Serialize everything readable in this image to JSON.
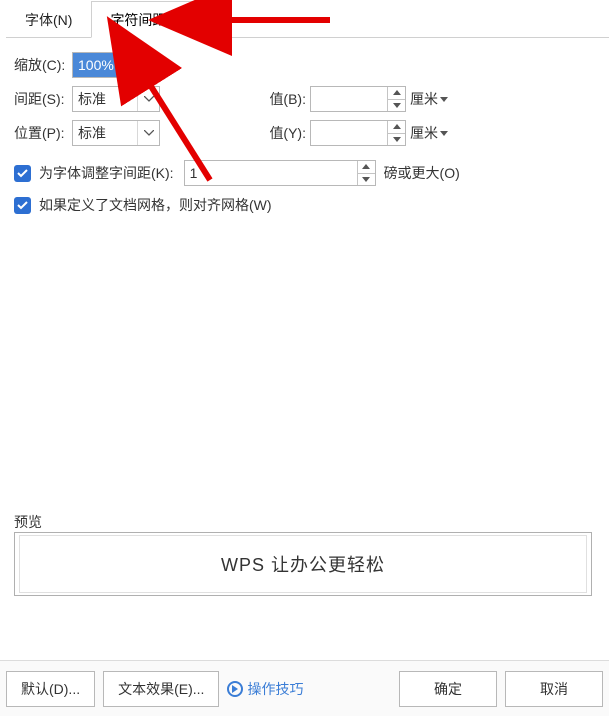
{
  "tabs": {
    "font": "字体(N)",
    "spacing": "字符间距(R)"
  },
  "labels": {
    "scale": "缩放(C):",
    "spacing": "间距(S):",
    "position": "位置(P):",
    "valueB": "值(B):",
    "valueY": "值(Y):",
    "cm": "厘米",
    "ptOrLarger": "磅或更大(O)",
    "kerning": "为字体调整字间距(K):",
    "snapGrid": "如果定义了文档网格，则对齐网格(W)",
    "preview": "预览"
  },
  "values": {
    "scale": "100%",
    "spacing": "标准",
    "position": "标准",
    "valueB": "",
    "valueY": "",
    "kerning": "1"
  },
  "previewText": "WPS 让办公更轻松",
  "footer": {
    "default": "默认(D)...",
    "textEffect": "文本效果(E)...",
    "tips": "操作技巧",
    "ok": "确定",
    "cancel": "取消"
  }
}
